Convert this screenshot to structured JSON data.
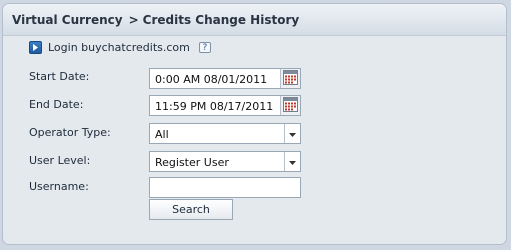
{
  "header": {
    "section": "Virtual Currency",
    "separator": ">",
    "page": "Credits Change History"
  },
  "login": {
    "icon": "play-icon",
    "label": "Login buychatcredits.com",
    "help_icon_text": "?"
  },
  "form": {
    "start_date": {
      "label": "Start Date:",
      "value": "0:00 AM 08/01/2011"
    },
    "end_date": {
      "label": "End Date:",
      "value": "11:59 PM 08/17/2011"
    },
    "operator_type": {
      "label": "Operator Type:",
      "value": "All"
    },
    "user_level": {
      "label": "User Level:",
      "value": "Register User"
    },
    "username": {
      "label": "Username:",
      "value": ""
    },
    "search_label": "Search"
  },
  "colors": {
    "background": "#cfd8e2",
    "panel": "#e4e9ee",
    "accent": "#1f5a9e",
    "calendar_red": "#c0392b"
  }
}
